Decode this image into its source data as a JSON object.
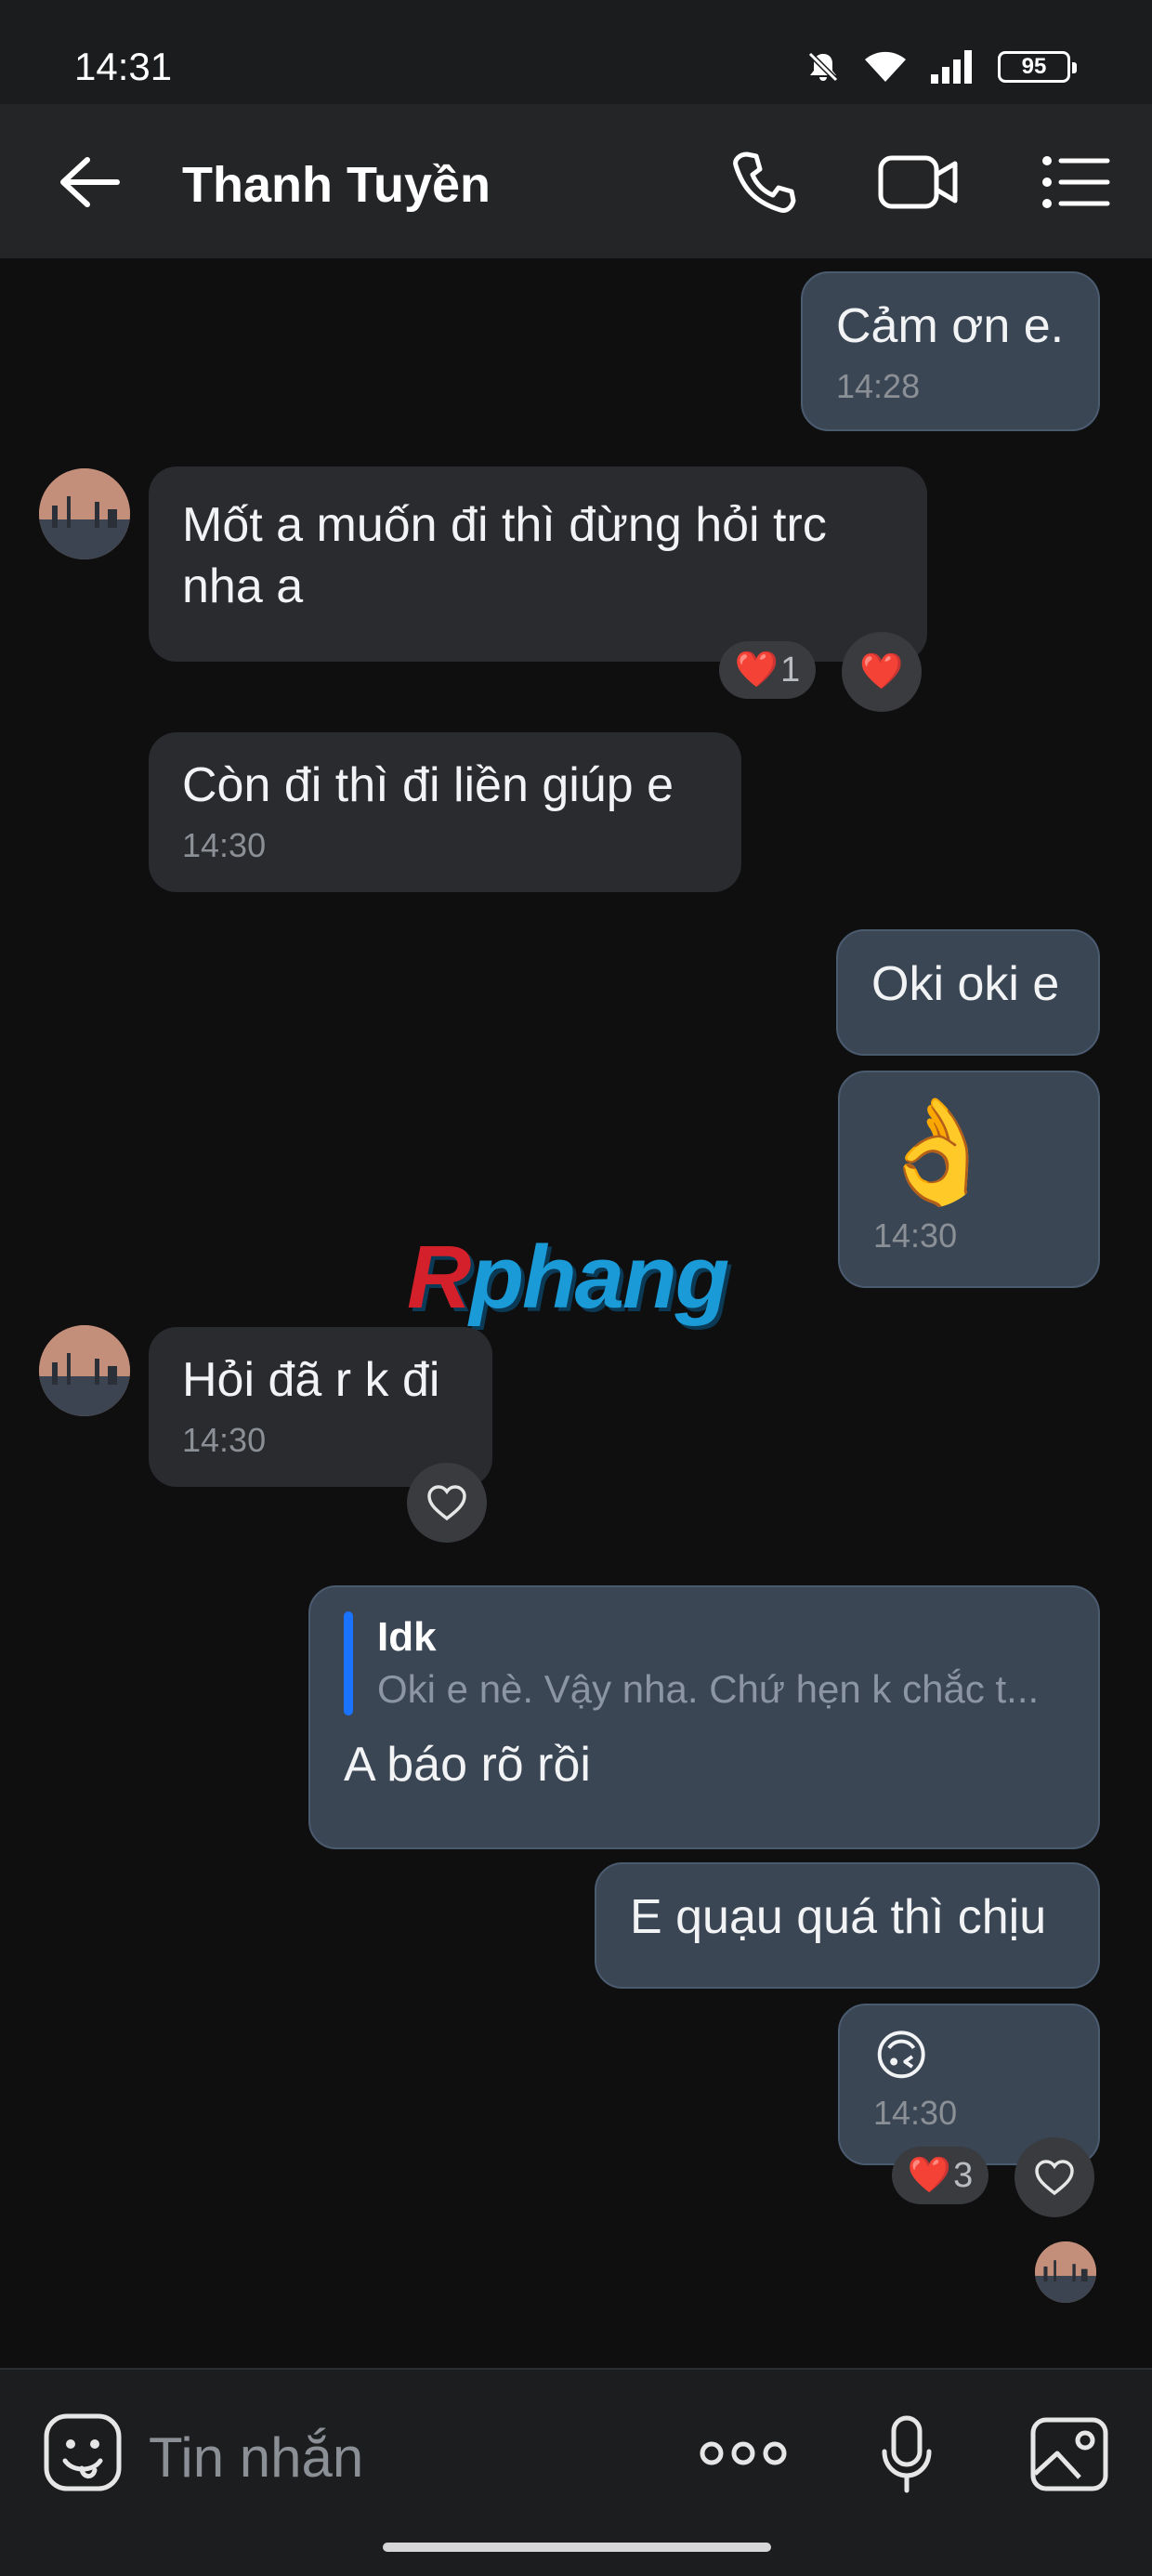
{
  "status_bar": {
    "time": "14:31",
    "battery": "95"
  },
  "header": {
    "title": "Thanh Tuyền"
  },
  "messages": [
    {
      "text": "Cảm ơn e.",
      "time": "14:28"
    },
    {
      "text": "Mốt a muốn đi thì đừng hỏi trc nha a",
      "reaction": "❤️",
      "reaction_count": "1"
    },
    {
      "text": "Còn đi thì đi liền giúp e",
      "time": "14:30"
    },
    {
      "text": "Oki oki e"
    },
    {
      "emoji": "👌",
      "time": "14:30"
    },
    {
      "text": "Hỏi đã r k đi",
      "time": "14:30"
    },
    {
      "reply_name": "Idk",
      "reply_text": "Oki e nè. Vậy nha. Chứ hẹn k chắc t...",
      "text": "A báo rõ rồi"
    },
    {
      "text": "E quạu quá thì chịu"
    },
    {
      "emoji": "🙃",
      "time": "14:30",
      "reaction": "❤️",
      "reaction_count": "3"
    }
  ],
  "reactions": {
    "heart": "❤️"
  },
  "watermark": {
    "r": "R",
    "rest": "phang"
  },
  "input": {
    "placeholder": "Tin nhắn"
  },
  "colors": {
    "accent": "#1a73ff",
    "outgoing_bubble": "#3b4655",
    "incoming_bubble": "#2a2b2e",
    "header": "#242527"
  },
  "icons": [
    "back-arrow-icon",
    "phone-icon",
    "video-camera-icon",
    "menu-list-icon",
    "emoji-icon",
    "more-dots-icon",
    "microphone-icon",
    "image-icon",
    "heart-icon",
    "mute-icon",
    "wifi-icon",
    "signal-icon"
  ]
}
